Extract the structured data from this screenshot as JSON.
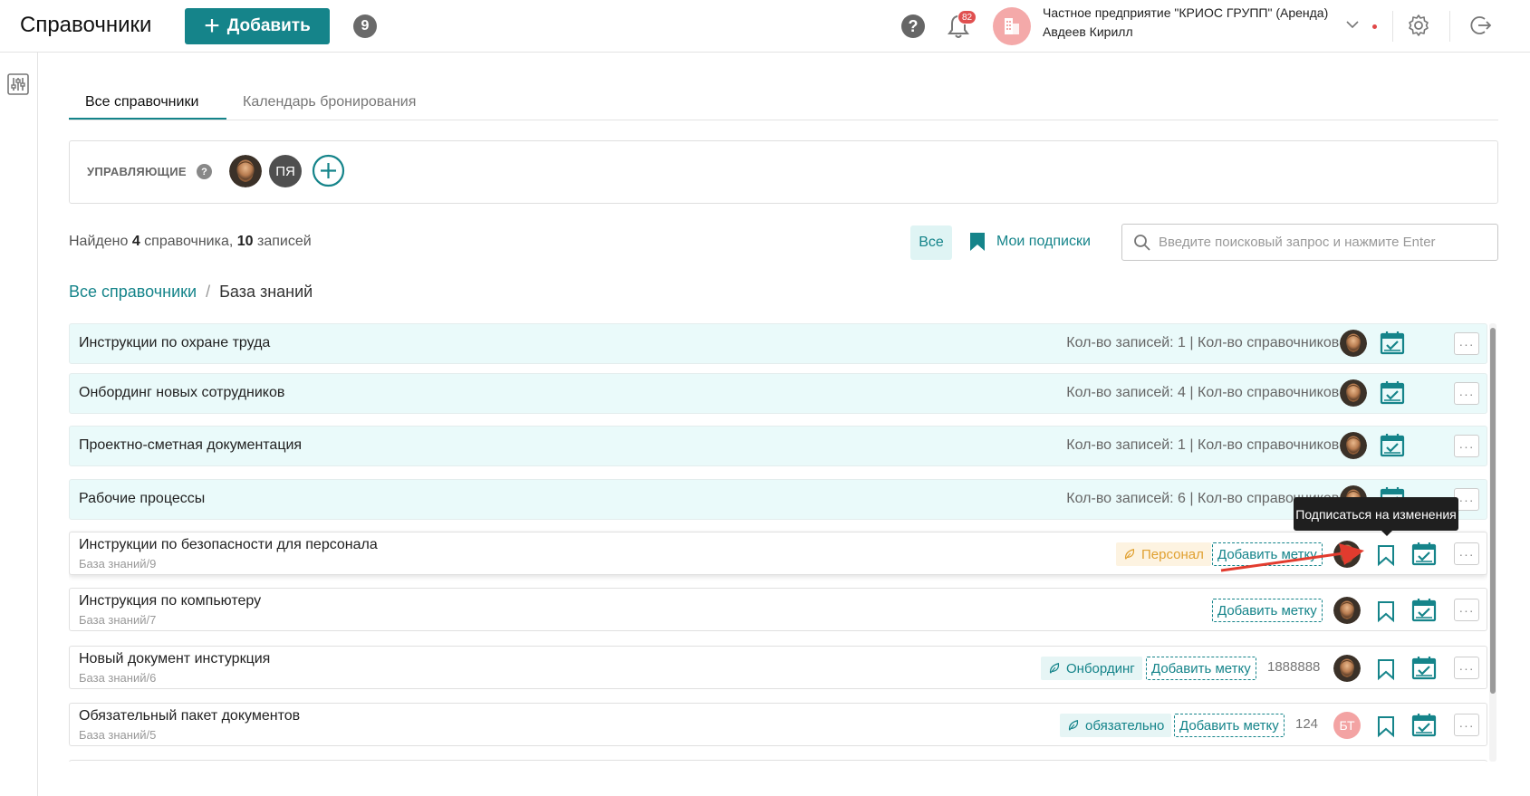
{
  "header": {
    "title": "Справочники",
    "add_label": "Добавить",
    "count": "9",
    "help": "?",
    "notifications": "82",
    "org": "Частное предприятие \"КРИОС ГРУПП\" (Аренда)",
    "user": "Авдеев Кирилл"
  },
  "tabs": [
    "Все справочники",
    "Календарь бронирования"
  ],
  "managers": {
    "label": "УПРАВЛЯЮЩИЕ",
    "help": "?",
    "initials": "ПЯ"
  },
  "found": {
    "prefix": "Найдено ",
    "dirs": "4",
    "middle": " справочника, ",
    "records": "10",
    "suffix": " записей"
  },
  "filters": {
    "all": "Все",
    "subscriptions": "Мои подписки"
  },
  "search": {
    "placeholder": "Введите поисковый запрос и нажмите Enter"
  },
  "breadcrumb": {
    "root": "Все справочники",
    "sep": "/",
    "current": "База знаний"
  },
  "folders": [
    {
      "title": "Инструкции по охране труда",
      "stats": "Кол-во записей: 1 | Кол-во справочников: 3"
    },
    {
      "title": "Онбординг новых сотрудников",
      "stats": "Кол-во записей: 4 | Кол-во справочников: 0"
    },
    {
      "title": "Проектно-сметная документация",
      "stats": "Кол-во записей: 1 | Кол-во справочников: 0"
    },
    {
      "title": "Рабочие процессы",
      "stats": "Кол-во записей: 6 | Кол-во справочников: 0"
    }
  ],
  "docs": [
    {
      "title": "Инструкции по безопасности для персонала",
      "path": "База знаний/9",
      "tag": "Персонал",
      "add_tag": "Добавить метку"
    },
    {
      "title": "Инструкция по компьютеру",
      "path": "База знаний/7",
      "add_tag": "Добавить метку"
    },
    {
      "title": "Новый документ инстуркция",
      "path": "База знаний/6",
      "tag": "Онбординг",
      "add_tag": "Добавить метку",
      "num": "1888888"
    },
    {
      "title": "Обязательный пакет документов",
      "path": "База знаний/5",
      "tag": "обязательно",
      "add_tag": "Добавить метку",
      "num": "124",
      "avatar": "БТ"
    }
  ],
  "more": "···",
  "tooltip": "Подписаться на изменения",
  "colors": {
    "accent": "#15848a",
    "folder_bg": "#eafafa",
    "tag_orange": "#e0a030",
    "danger": "#e04848"
  }
}
